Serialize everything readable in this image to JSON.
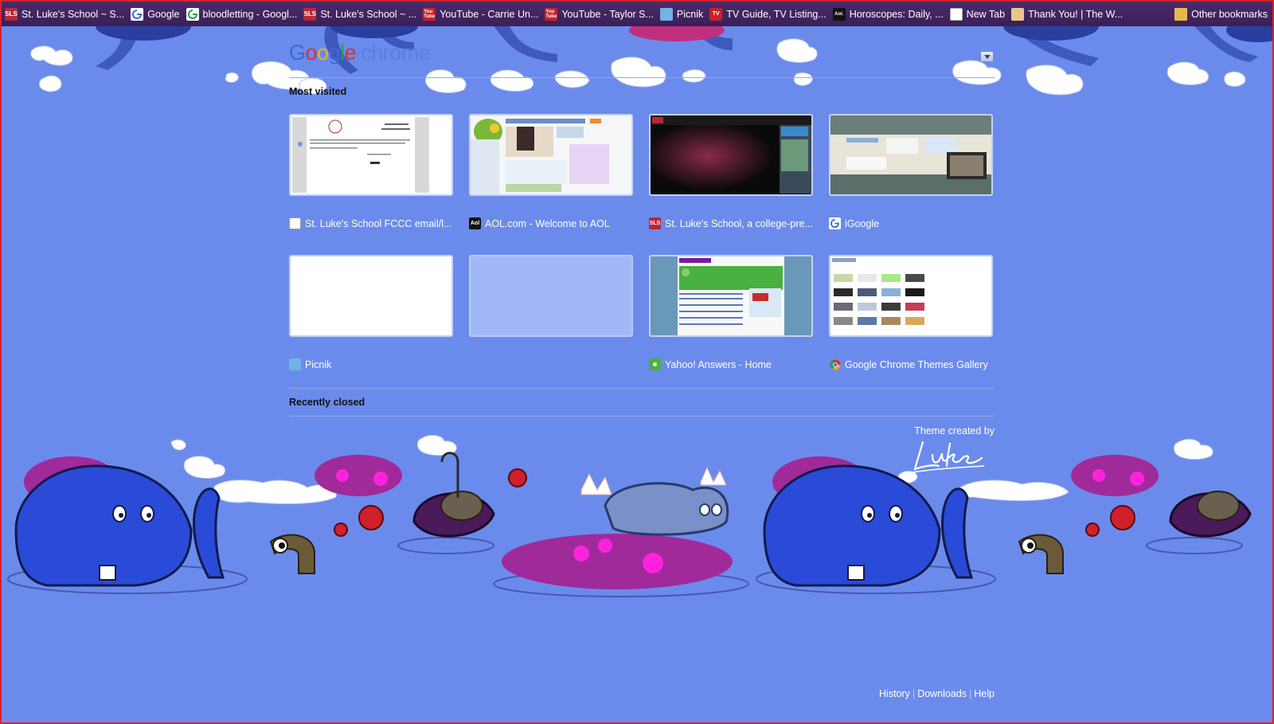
{
  "bookmarks": [
    {
      "label": "St. Luke's School ~ S...",
      "icon": "sls-icon"
    },
    {
      "label": "Google",
      "icon": "google-icon"
    },
    {
      "label": "bloodletting - Googl...",
      "icon": "google-icon"
    },
    {
      "label": "St. Luke's School ~ ...",
      "icon": "sls-icon"
    },
    {
      "label": "YouTube - Carrie Un...",
      "icon": "youtube-icon"
    },
    {
      "label": "YouTube - Taylor S...",
      "icon": "youtube-icon"
    },
    {
      "label": "Picnik",
      "icon": "picnik-icon"
    },
    {
      "label": "TV Guide, TV Listing...",
      "icon": "tv-guide-icon"
    },
    {
      "label": "Horoscopes: Daily, ...",
      "icon": "aol-icon"
    },
    {
      "label": "New Tab",
      "icon": "page-icon"
    },
    {
      "label": "Thank You! | The W...",
      "icon": "thank-you-icon"
    }
  ],
  "other_bookmarks": "Other bookmarks",
  "logo": {
    "google": [
      "G",
      "o",
      "o",
      "g",
      "l",
      "e"
    ],
    "chrome": "chrome"
  },
  "most_visited": {
    "title": "Most visited",
    "tiles": [
      {
        "label": "St. Luke's School FCCC email/l...",
        "icon": "page-icon"
      },
      {
        "label": "AOL.com - Welcome to AOL",
        "icon": "aol-icon"
      },
      {
        "label": "St. Luke's School, a college-pre...",
        "icon": "sls-icon"
      },
      {
        "label": "iGoogle",
        "icon": "google-icon"
      },
      {
        "label": "Picnik",
        "icon": "picnik-icon"
      },
      {
        "label": "",
        "icon": ""
      },
      {
        "label": "Yahoo! Answers - Home",
        "icon": "yahoo-answers-icon"
      },
      {
        "label": "Google Chrome Themes Gallery",
        "icon": "chrome-icon"
      }
    ]
  },
  "recently_closed": {
    "title": "Recently closed"
  },
  "attribution": {
    "text": "Theme created by",
    "signature": "Luke"
  },
  "footer": {
    "history": "History",
    "downloads": "Downloads",
    "help": "Help"
  },
  "colors": {
    "background": "#6b8bec",
    "bookmarks_bar": "#3a1f58",
    "frame": "#e0202a"
  }
}
